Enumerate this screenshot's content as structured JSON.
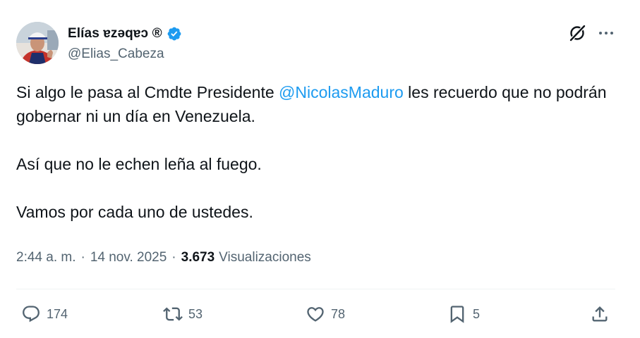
{
  "author": {
    "display_name": "Elías ɐzǝqɐɔ ®",
    "handle": "@Elias_Cabeza"
  },
  "tweet": {
    "line1_prefix": "Si algo le pasa al Cmdte Presidente ",
    "mention": "@NicolasMaduro",
    "line1_suffix": " les recuerdo que no podrán gobernar ni un día en Venezuela.",
    "para2": "Así que no le echen leña al fuego.",
    "para3": "Vamos por cada uno de ustedes."
  },
  "meta": {
    "time": "2:44 a. m.",
    "date": "14 nov. 2025",
    "views_count": "3.673",
    "views_label": "Visualizaciones"
  },
  "actions": {
    "reply": "174",
    "repost": "53",
    "like": "78",
    "bookmark": "5"
  },
  "icons": [
    "grok-icon",
    "more-icon",
    "verified-badge-icon",
    "reply-icon",
    "repost-icon",
    "like-icon",
    "bookmark-icon",
    "share-icon"
  ],
  "colors": {
    "text": "#0f1419",
    "secondary": "#536471",
    "link": "#1d9bf0",
    "verified": "#1d9bf0",
    "divider": "#eff3f4"
  }
}
